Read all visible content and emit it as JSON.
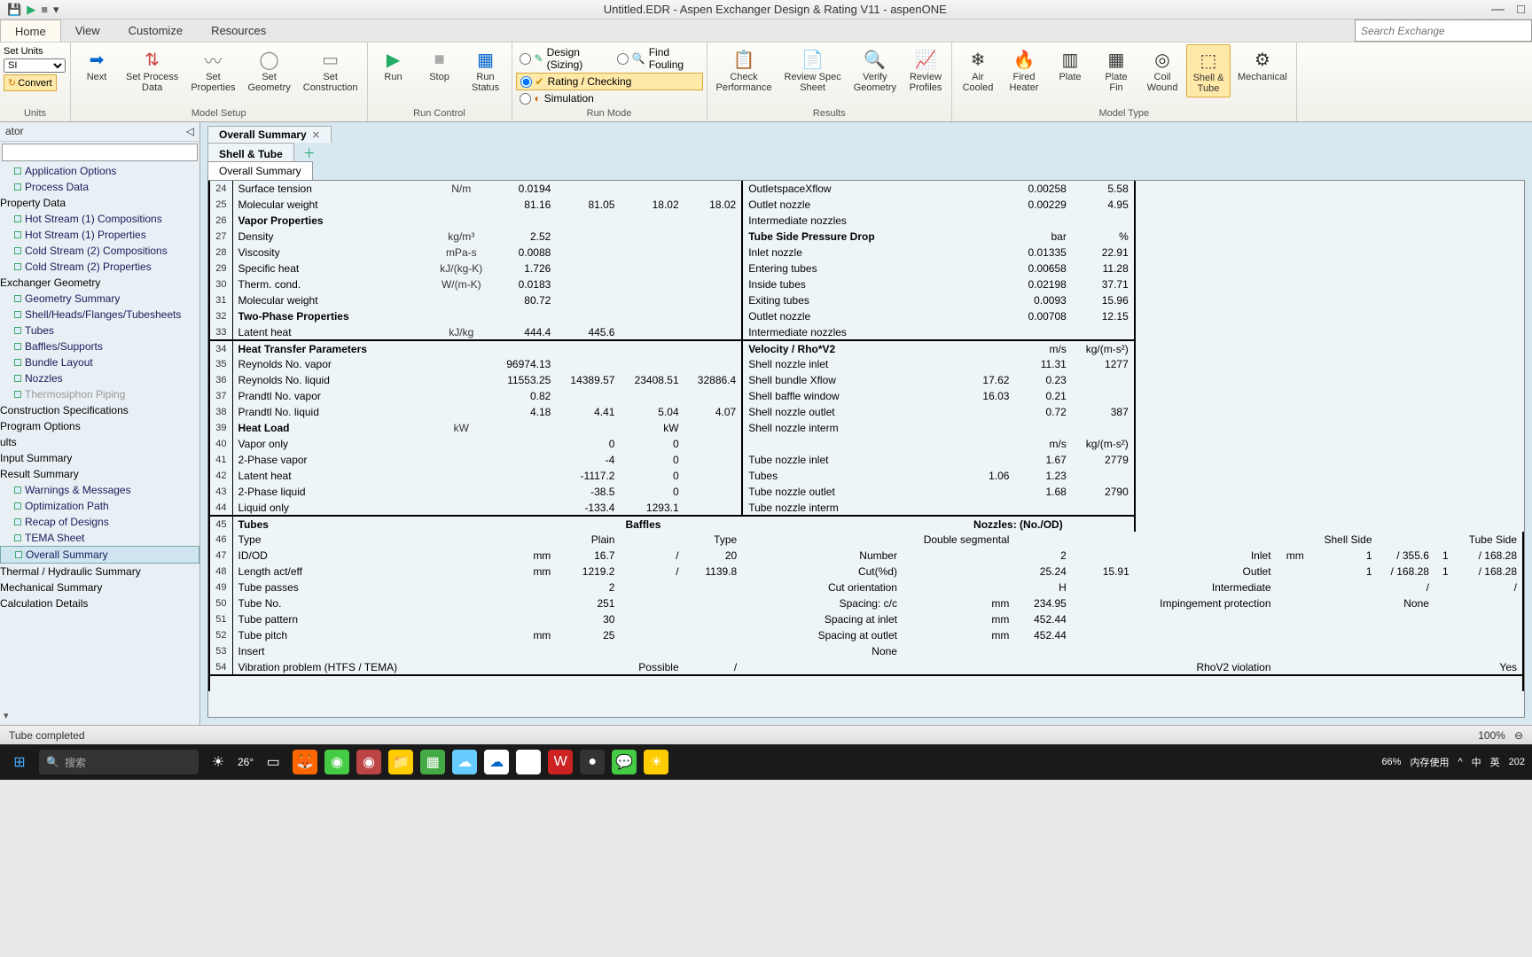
{
  "title": "Untitled.EDR - Aspen Exchanger Design & Rating V11 - aspenONE",
  "window_controls": {
    "min": "—",
    "max": "□"
  },
  "menu": {
    "home": "Home",
    "view": "View",
    "customize": "Customize",
    "resources": "Resources"
  },
  "search": {
    "placeholder": "Search Exchange"
  },
  "ribbon": {
    "units": {
      "label": "Units",
      "set_units": "Set Units",
      "dropdown_value": "SI",
      "convert": "Convert"
    },
    "model_setup": {
      "label": "Model Setup",
      "next": "Next",
      "process": "Set Process\nData",
      "properties": "Set\nProperties",
      "geometry": "Set\nGeometry",
      "construction": "Set\nConstruction"
    },
    "run_control": {
      "label": "Run Control",
      "run": "Run",
      "stop": "Stop",
      "status": "Run\nStatus"
    },
    "run_mode": {
      "label": "Run Mode",
      "design": "Design (Sizing)",
      "rating": "Rating / Checking",
      "simulation": "Simulation",
      "fouling": "Find Fouling"
    },
    "results": {
      "label": "Results",
      "check": "Check\nPerformance",
      "spec": "Review Spec\nSheet",
      "verify": "Verify\nGeometry",
      "profiles": "Review\nProfiles"
    },
    "model_type": {
      "label": "Model Type",
      "air": "Air\nCooled",
      "fired": "Fired\nHeater",
      "plate": "Plate",
      "platefin": "Plate\nFin",
      "coil": "Coil\nWound",
      "shell": "Shell &\nTube",
      "mech": "Mechanical"
    }
  },
  "nav_header": "ator",
  "nav": [
    {
      "lbl": "Application Options",
      "lvl": 1
    },
    {
      "lbl": "Process Data",
      "lvl": 1
    },
    {
      "lbl": "Property Data",
      "lvl": 0
    },
    {
      "lbl": "Hot Stream (1) Compositions",
      "lvl": 1
    },
    {
      "lbl": "Hot Stream (1) Properties",
      "lvl": 1
    },
    {
      "lbl": "Cold Stream (2) Compositions",
      "lvl": 1
    },
    {
      "lbl": "Cold Stream (2) Properties",
      "lvl": 1
    },
    {
      "lbl": "Exchanger Geometry",
      "lvl": 0
    },
    {
      "lbl": "Geometry Summary",
      "lvl": 1
    },
    {
      "lbl": "Shell/Heads/Flanges/Tubesheets",
      "lvl": 1
    },
    {
      "lbl": "Tubes",
      "lvl": 1
    },
    {
      "lbl": "Baffles/Supports",
      "lvl": 1
    },
    {
      "lbl": "Bundle Layout",
      "lvl": 1
    },
    {
      "lbl": "Nozzles",
      "lvl": 1
    },
    {
      "lbl": "Thermosiphon Piping",
      "lvl": 1,
      "muted": true
    },
    {
      "lbl": "Construction Specifications",
      "lvl": 0
    },
    {
      "lbl": "Program Options",
      "lvl": 0
    },
    {
      "lbl": "ults",
      "lvl": 0
    },
    {
      "lbl": "Input Summary",
      "lvl": 0
    },
    {
      "lbl": "Result Summary",
      "lvl": 0
    },
    {
      "lbl": "Warnings & Messages",
      "lvl": 1
    },
    {
      "lbl": "Optimization Path",
      "lvl": 1
    },
    {
      "lbl": "Recap of Designs",
      "lvl": 1
    },
    {
      "lbl": "TEMA Sheet",
      "lvl": 1
    },
    {
      "lbl": "Overall Summary",
      "lvl": 1,
      "selected": true
    },
    {
      "lbl": "Thermal / Hydraulic Summary",
      "lvl": 0
    },
    {
      "lbl": "Mechanical Summary",
      "lvl": 0
    },
    {
      "lbl": "Calculation Details",
      "lvl": 0
    }
  ],
  "tabs": {
    "tab1": "Overall Summary",
    "tab2": "Shell & Tube",
    "subtab": "Overall Summary"
  },
  "leftRows": [
    {
      "n": "24",
      "lbl": "Surface tension",
      "unit": "N/m",
      "v": [
        "0.0194",
        "",
        "",
        ""
      ]
    },
    {
      "n": "25",
      "lbl": "Molecular weight",
      "unit": "",
      "v": [
        "81.16",
        "81.05",
        "18.02",
        "18.02"
      ]
    },
    {
      "n": "26",
      "lbl": "Vapor Properties",
      "bold": true,
      "unit": "",
      "v": [
        "",
        "",
        "",
        ""
      ]
    },
    {
      "n": "27",
      "lbl": "Density",
      "unit": "kg/m³",
      "v": [
        "2.52",
        "",
        "",
        ""
      ]
    },
    {
      "n": "28",
      "lbl": "Viscosity",
      "unit": "mPa-s",
      "v": [
        "0.0088",
        "",
        "",
        ""
      ]
    },
    {
      "n": "29",
      "lbl": "Specific heat",
      "unit": "kJ/(kg-K)",
      "v": [
        "1.726",
        "",
        "",
        ""
      ]
    },
    {
      "n": "30",
      "lbl": "Therm. cond.",
      "unit": "W/(m-K)",
      "v": [
        "0.0183",
        "",
        "",
        ""
      ]
    },
    {
      "n": "31",
      "lbl": "Molecular weight",
      "unit": "",
      "v": [
        "80.72",
        "",
        "",
        ""
      ]
    },
    {
      "n": "32",
      "lbl": "Two-Phase Properties",
      "bold": true,
      "unit": "",
      "v": [
        "",
        "",
        "",
        ""
      ]
    },
    {
      "n": "33",
      "lbl": "Latent heat",
      "unit": "kJ/kg",
      "v": [
        "444.4",
        "445.6",
        "",
        ""
      ]
    },
    {
      "n": "34",
      "lbl": "Heat Transfer Parameters",
      "bold": true,
      "unit": "",
      "v": [
        "",
        "",
        "",
        ""
      ],
      "sep": true
    },
    {
      "n": "35",
      "lbl": "Reynolds No. vapor",
      "unit": "",
      "v": [
        "96974.13",
        "",
        "",
        ""
      ]
    },
    {
      "n": "36",
      "lbl": "Reynolds No. liquid",
      "unit": "",
      "v": [
        "11553.25",
        "14389.57",
        "23408.51",
        "32886.4"
      ]
    },
    {
      "n": "37",
      "lbl": "Prandtl No. vapor",
      "unit": "",
      "v": [
        "0.82",
        "",
        "",
        ""
      ]
    },
    {
      "n": "38",
      "lbl": "Prandtl No. liquid",
      "unit": "",
      "v": [
        "4.18",
        "4.41",
        "5.04",
        "4.07"
      ]
    },
    {
      "n": "39",
      "lbl": "Heat  Load",
      "bold": true,
      "unit": "kW",
      "v": [
        "",
        "",
        "kW",
        ""
      ]
    },
    {
      "n": "40",
      "lbl": "Vapor only",
      "unit": "",
      "v": [
        "",
        "0",
        "0",
        ""
      ]
    },
    {
      "n": "41",
      "lbl": "2-Phase vapor",
      "unit": "",
      "v": [
        "",
        "-4",
        "0",
        ""
      ]
    },
    {
      "n": "42",
      "lbl": "Latent heat",
      "unit": "",
      "v": [
        "",
        "-1117.2",
        "0",
        ""
      ]
    },
    {
      "n": "43",
      "lbl": "2-Phase liquid",
      "unit": "",
      "v": [
        "",
        "-38.5",
        "0",
        ""
      ]
    },
    {
      "n": "44",
      "lbl": "Liquid only",
      "unit": "",
      "v": [
        "",
        "-133.4",
        "1293.1",
        ""
      ]
    }
  ],
  "rightRows": [
    {
      "lbl": "OutletspaceXflow",
      "v": [
        "",
        "0.00258",
        "5.58"
      ]
    },
    {
      "lbl": "Outlet nozzle",
      "v": [
        "",
        "0.00229",
        "4.95"
      ]
    },
    {
      "lbl": "Intermediate nozzles",
      "v": [
        "",
        "",
        ""
      ]
    },
    {
      "lbl": "Tube Side Pressure Drop",
      "bold": true,
      "v": [
        "",
        "bar",
        "%"
      ]
    },
    {
      "lbl": "Inlet nozzle",
      "v": [
        "",
        "0.01335",
        "22.91"
      ]
    },
    {
      "lbl": "Entering tubes",
      "v": [
        "",
        "0.00658",
        "11.28"
      ]
    },
    {
      "lbl": "Inside tubes",
      "v": [
        "",
        "0.02198",
        "37.71"
      ]
    },
    {
      "lbl": "Exiting tubes",
      "v": [
        "",
        "0.0093",
        "15.96"
      ]
    },
    {
      "lbl": "Outlet nozzle",
      "v": [
        "",
        "0.00708",
        "12.15"
      ]
    },
    {
      "lbl": "Intermediate nozzles",
      "v": [
        "",
        "",
        ""
      ]
    },
    {
      "lbl": "Velocity     /   Rho*V2",
      "bold": true,
      "v": [
        "",
        "m/s",
        "kg/(m-s²)"
      ],
      "sep": true
    },
    {
      "lbl": "Shell nozzle inlet",
      "v": [
        "",
        "11.31",
        "1277"
      ]
    },
    {
      "lbl": "Shell bundle Xflow",
      "v": [
        "17.62",
        "0.23",
        ""
      ]
    },
    {
      "lbl": "Shell baffle window",
      "v": [
        "16.03",
        "0.21",
        ""
      ]
    },
    {
      "lbl": "Shell nozzle outlet",
      "v": [
        "",
        "0.72",
        "387"
      ]
    },
    {
      "lbl": "Shell nozzle interm",
      "v": [
        "",
        "",
        ""
      ]
    },
    {
      "lbl": "",
      "v": [
        "",
        "m/s",
        "kg/(m-s²)"
      ]
    },
    {
      "lbl": "Tube nozzle inlet",
      "v": [
        "",
        "1.67",
        "2779"
      ]
    },
    {
      "lbl": "Tubes",
      "v": [
        "1.06",
        "1.23",
        ""
      ]
    },
    {
      "lbl": "Tube nozzle outlet",
      "v": [
        "",
        "1.68",
        "2790"
      ]
    },
    {
      "lbl": "Tube nozzle interm",
      "v": [
        "",
        "",
        ""
      ]
    }
  ],
  "tubes": {
    "hdr_tubes": "Tubes",
    "hdr_baffles": "Baffles",
    "hdr_nozzles": "Nozzles: (No./OD)",
    "rows": [
      {
        "n": "46",
        "c": [
          "Type",
          "",
          "",
          "Plain",
          "",
          "Type",
          "",
          "Double segmental",
          "",
          "",
          "",
          "",
          "Shell Side",
          "",
          "",
          "Tube Side"
        ]
      },
      {
        "n": "47",
        "c": [
          "ID/OD",
          "",
          "mm",
          "16.7",
          "/",
          "20",
          "Number",
          "",
          "2",
          "",
          "Inlet",
          "mm",
          "1",
          "/  355.6",
          "1",
          "/  168.28"
        ]
      },
      {
        "n": "48",
        "c": [
          "Length act/eff",
          "",
          "mm",
          "1219.2",
          "/",
          "1139.8",
          "Cut(%d)",
          "",
          "25.24",
          "15.91",
          "Outlet",
          "",
          "1",
          "/  168.28",
          "1",
          "/  168.28"
        ]
      },
      {
        "n": "49",
        "c": [
          "Tube passes",
          "",
          "",
          "2",
          "",
          "",
          "Cut orientation",
          "",
          "H",
          "",
          "Intermediate",
          "",
          "",
          "/",
          "",
          "/"
        ]
      },
      {
        "n": "50",
        "c": [
          "Tube No.",
          "",
          "",
          "251",
          "",
          "",
          "Spacing: c/c",
          "mm",
          "234.95",
          "",
          "Impingement protection",
          "",
          "",
          "None",
          "",
          ""
        ]
      },
      {
        "n": "51",
        "c": [
          "Tube pattern",
          "",
          "",
          "30",
          "",
          "",
          "Spacing at inlet",
          "mm",
          "452.44",
          "",
          "",
          "",
          "",
          "",
          "",
          ""
        ]
      },
      {
        "n": "52",
        "c": [
          "Tube pitch",
          "",
          "mm",
          "25",
          "",
          "",
          "Spacing at outlet",
          "mm",
          "452.44",
          "",
          "",
          "",
          "",
          "",
          "",
          ""
        ]
      },
      {
        "n": "53",
        "c": [
          "Insert",
          "",
          "",
          "",
          "",
          "",
          "None",
          "",
          "",
          "",
          "",
          "",
          "",
          "",
          "",
          ""
        ]
      },
      {
        "n": "54",
        "c": [
          "Vibration problem (HTFS / TEMA)",
          "",
          "",
          "",
          "Possible",
          "/",
          "",
          "",
          "",
          "",
          "RhoV2 violation",
          "",
          "",
          "",
          "",
          "Yes"
        ]
      }
    ]
  },
  "status": {
    "msg": "Tube completed",
    "zoom": "100%"
  },
  "taskbar": {
    "search": "搜索",
    "temp": "26°",
    "pct": "66%",
    "mem": "内存使用",
    "lang1": "中",
    "lang2": "英",
    "year": "202"
  }
}
